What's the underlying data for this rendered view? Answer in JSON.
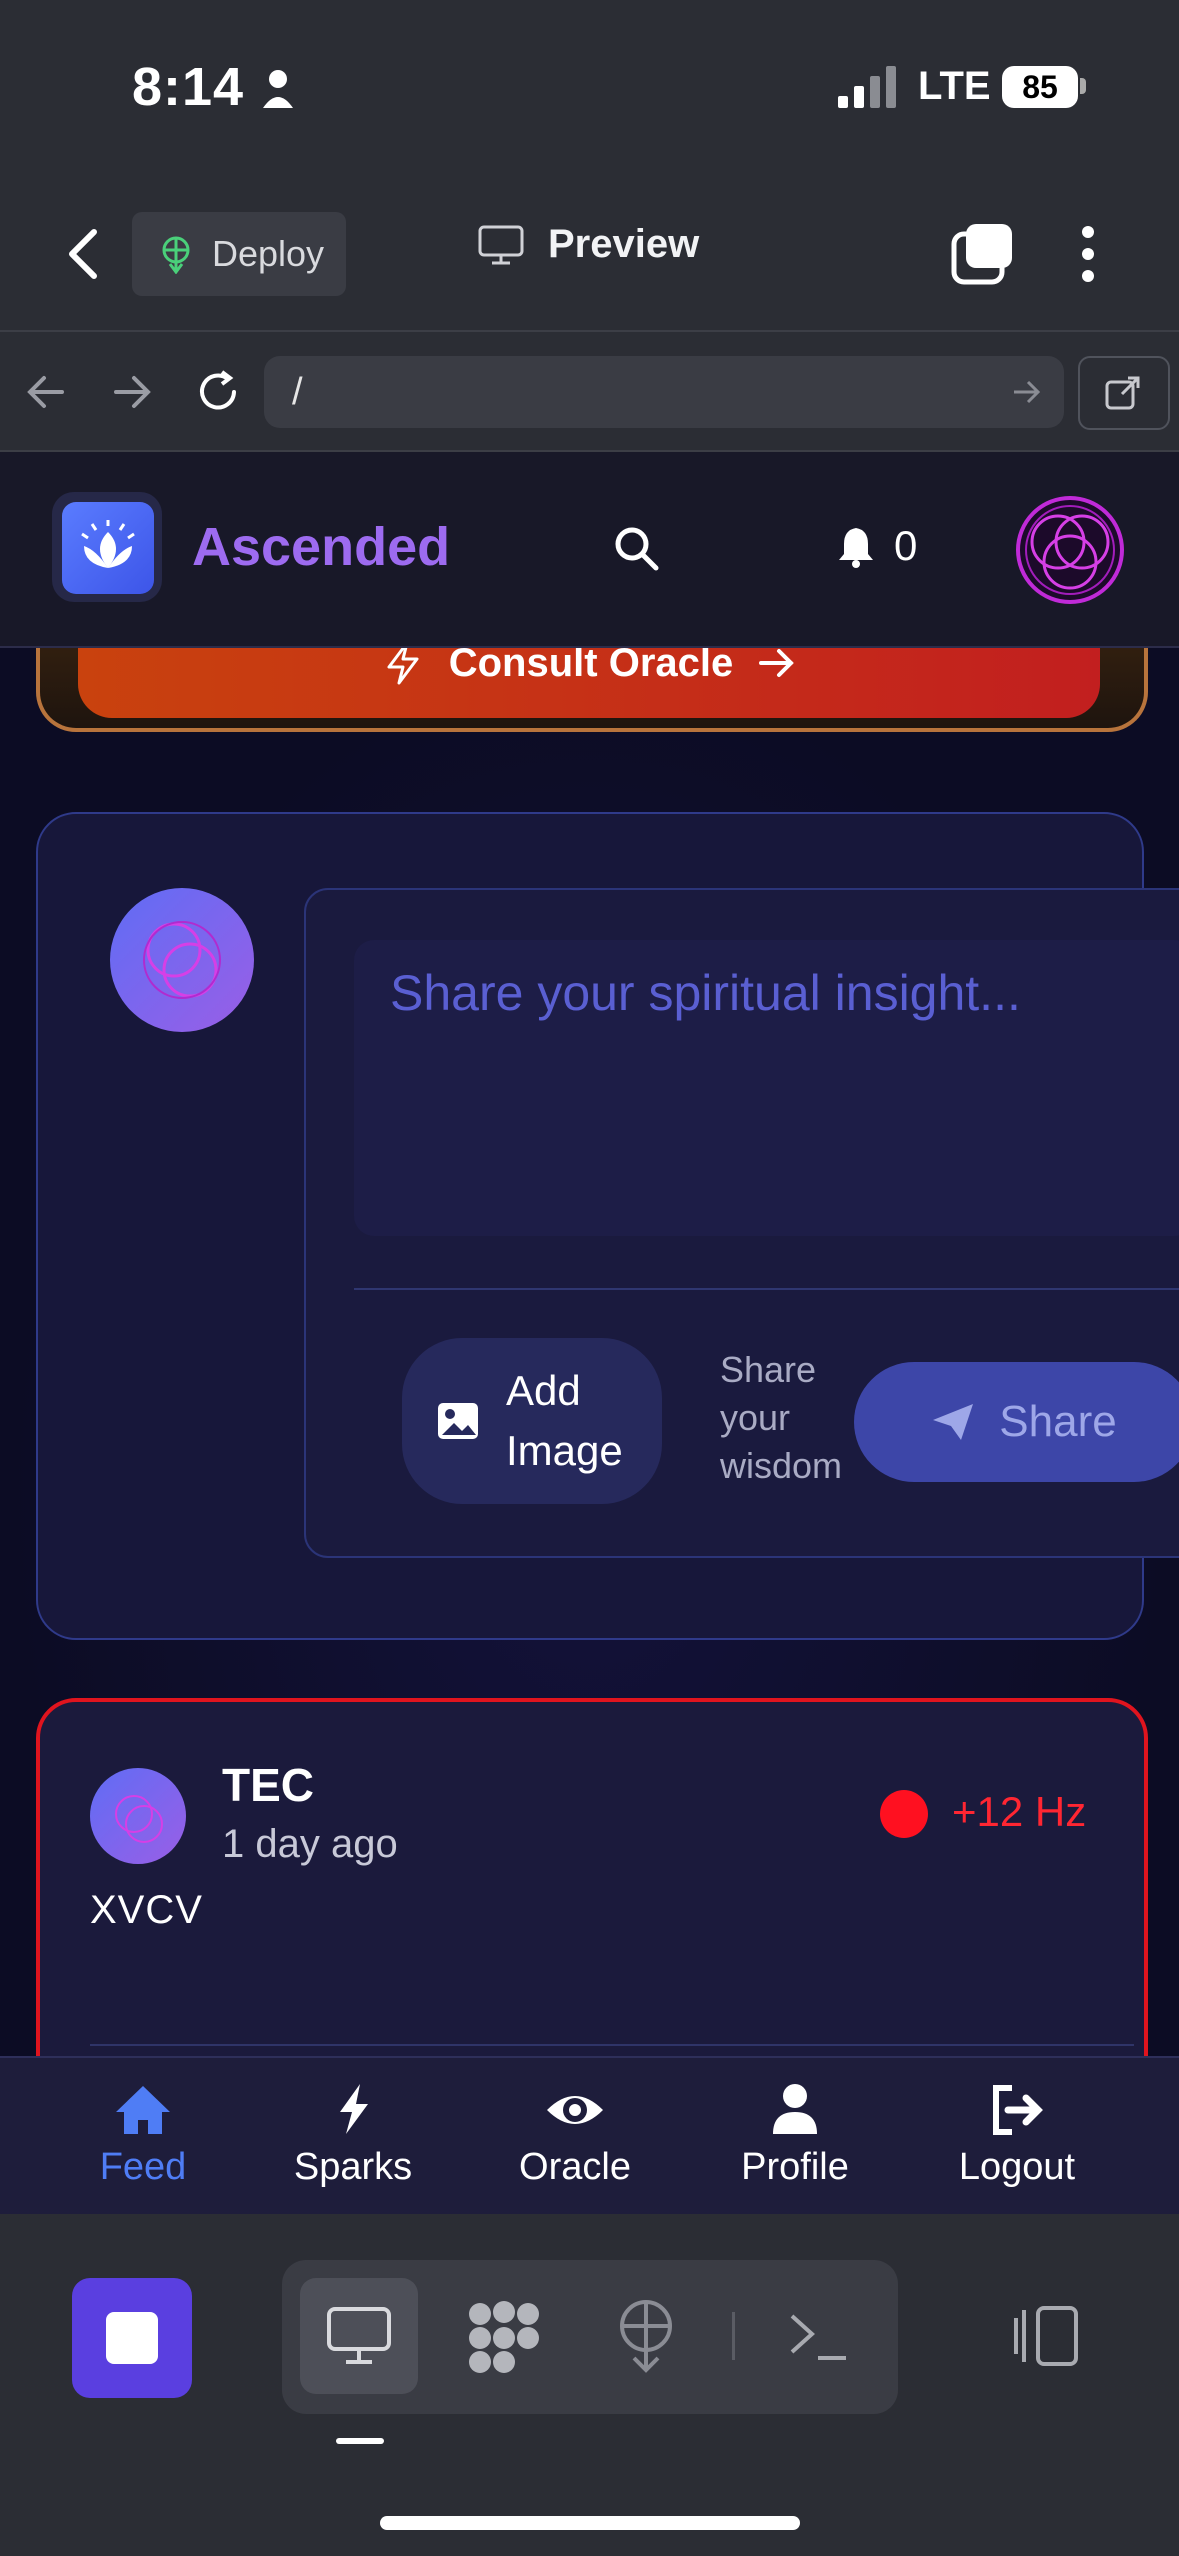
{
  "status_bar": {
    "time": "8:14",
    "network": "LTE",
    "battery": "85"
  },
  "toolbar": {
    "deploy_label": "Deploy",
    "preview_label": "Preview"
  },
  "browser": {
    "url": "/"
  },
  "app_header": {
    "brand": "Ascended",
    "notification_count": "0"
  },
  "oracle": {
    "button_label": "Consult Oracle"
  },
  "composer": {
    "placeholder": "Share your spiritual insight...",
    "add_image_label": "Add Image",
    "hint": "Share your wisdom",
    "share_label": "Share"
  },
  "post": {
    "username": "TEC",
    "time_ago": "1 day ago",
    "frequency": "+12 Hz",
    "body": "XVCV"
  },
  "bottom_nav": [
    {
      "label": "Feed",
      "icon": "home-icon",
      "active": true
    },
    {
      "label": "Sparks",
      "icon": "bolt-icon",
      "active": false
    },
    {
      "label": "Oracle",
      "icon": "eye-icon",
      "active": false
    },
    {
      "label": "Profile",
      "icon": "user-icon",
      "active": false
    },
    {
      "label": "Logout",
      "icon": "logout-icon",
      "active": false
    }
  ],
  "colors": {
    "brand": "#9d6bf0",
    "active_nav": "#4f7df5",
    "alert_red": "#e0141e",
    "oracle_orange": "#c9420e"
  }
}
